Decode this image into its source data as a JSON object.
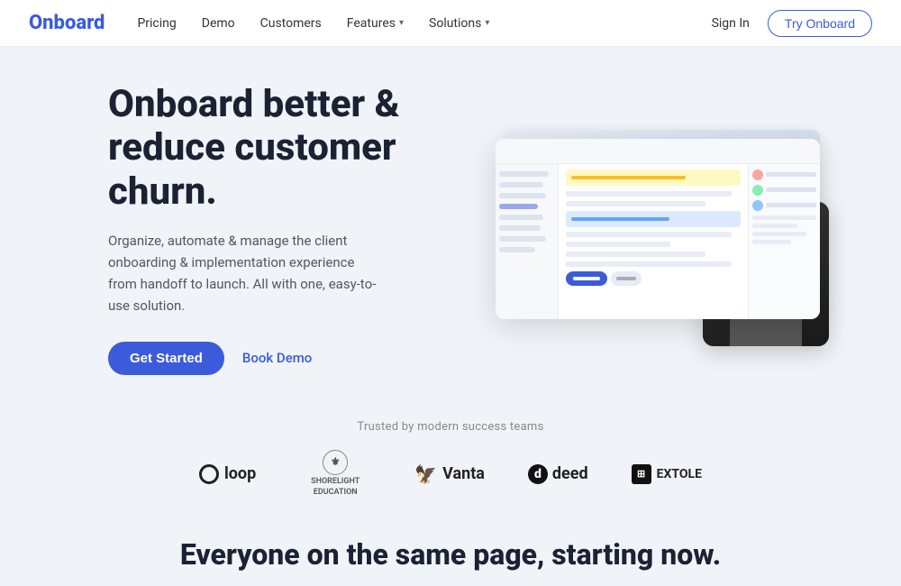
{
  "nav": {
    "logo": "Onboard",
    "links": [
      {
        "label": "Pricing",
        "hasDropdown": false
      },
      {
        "label": "Demo",
        "hasDropdown": false
      },
      {
        "label": "Customers",
        "hasDropdown": false
      },
      {
        "label": "Features",
        "hasDropdown": true
      },
      {
        "label": "Solutions",
        "hasDropdown": true
      }
    ],
    "signIn": "Sign In",
    "tryOnboard": "Try Onboard"
  },
  "hero": {
    "title": "Onboard better & reduce customer churn.",
    "subtitle": "Organize, automate & manage the client onboarding & implementation experience from handoff to launch. All with one, easy-to-use solution.",
    "cta_primary": "Get Started",
    "cta_secondary": "Book Demo"
  },
  "trusted": {
    "label": "Trusted by modern success teams",
    "logos": [
      {
        "name": "loop",
        "text": "loop"
      },
      {
        "name": "shorelight",
        "text": "SHORELIGHT EDUCATION"
      },
      {
        "name": "vanta",
        "text": "Vanta"
      },
      {
        "name": "deed",
        "text": "deed"
      },
      {
        "name": "extole",
        "text": "EXTOLE"
      }
    ]
  },
  "bottom": {
    "cta": "Everyone on the same page, starting now."
  },
  "colors": {
    "accent": "#3b5bdb",
    "bg": "#f0f4f8",
    "text_dark": "#1a2233",
    "text_muted": "#888"
  }
}
